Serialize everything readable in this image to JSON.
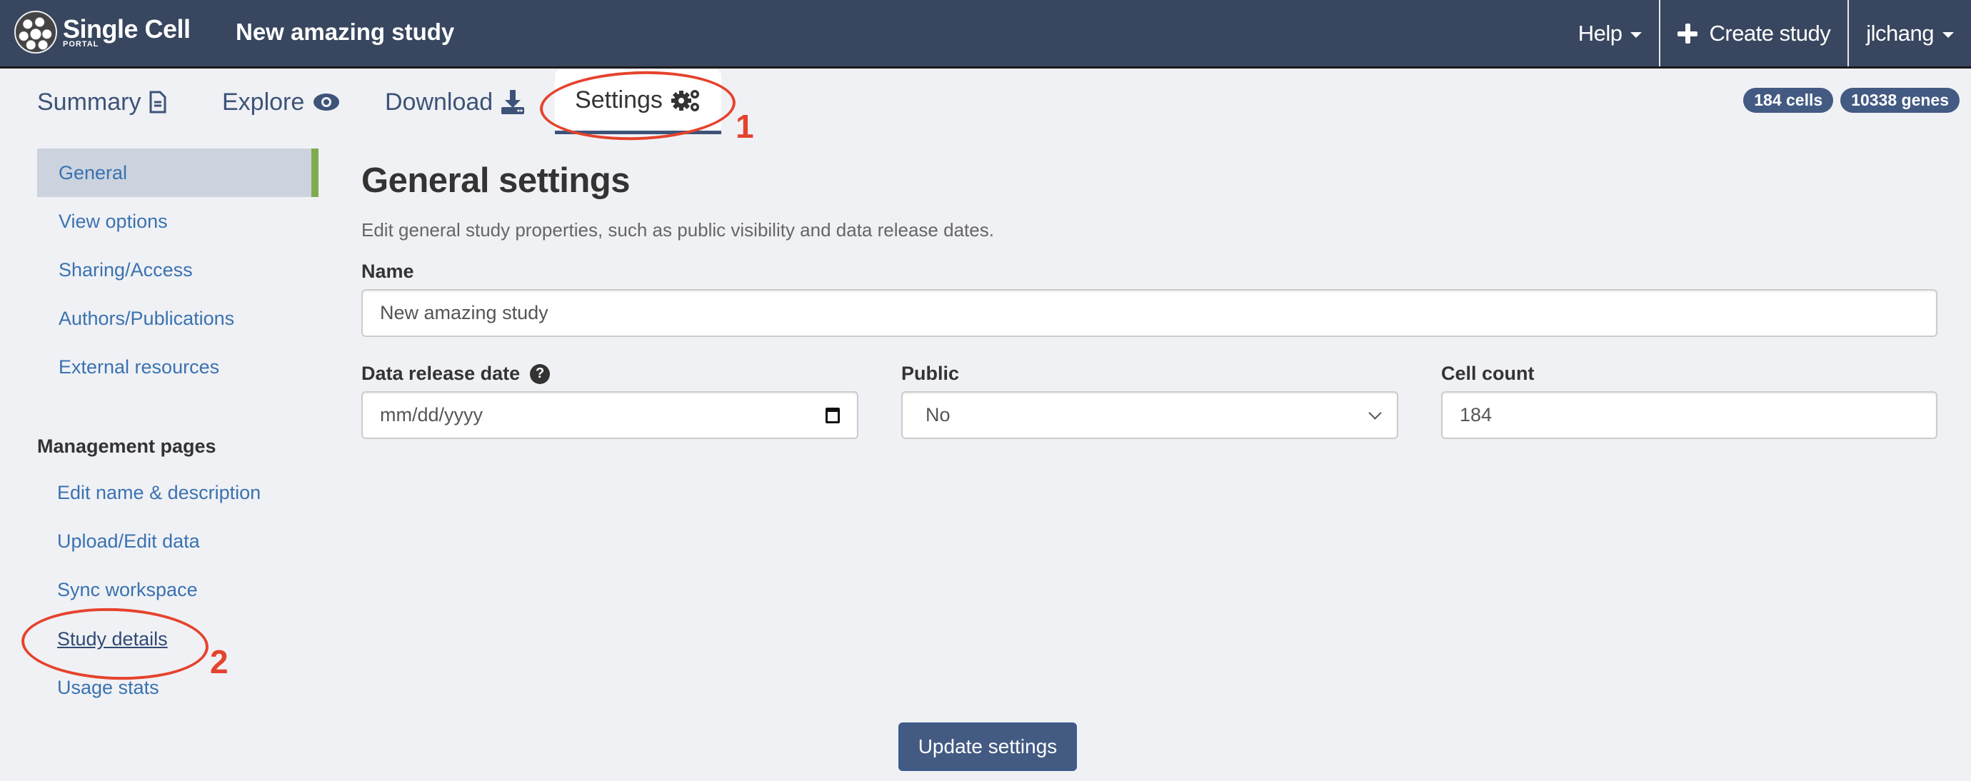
{
  "header": {
    "logo_main": "Single Cell",
    "logo_sub": "PORTAL",
    "study_title": "New amazing study",
    "nav": {
      "help": "Help",
      "create_study": "Create study",
      "user": "jlchang"
    }
  },
  "tabs": [
    {
      "label": "Summary",
      "icon": "document-icon"
    },
    {
      "label": "Explore",
      "icon": "eye-icon"
    },
    {
      "label": "Download",
      "icon": "download-icon"
    },
    {
      "label": "Settings",
      "icon": "gears-icon",
      "active": true
    }
  ],
  "badges": {
    "cells": "184 cells",
    "genes": "10338 genes"
  },
  "sidebar": {
    "items": [
      {
        "label": "General",
        "active": true
      },
      {
        "label": "View options"
      },
      {
        "label": "Sharing/Access"
      },
      {
        "label": "Authors/Publications"
      },
      {
        "label": "External resources"
      }
    ],
    "management_heading": "Management pages",
    "management_items": [
      {
        "label": "Edit name & description"
      },
      {
        "label": "Upload/Edit data"
      },
      {
        "label": "Sync workspace"
      },
      {
        "label": "Study details"
      },
      {
        "label": "Usage stats"
      }
    ]
  },
  "main": {
    "title": "General settings",
    "description": "Edit general study properties, such as public visibility and data release dates.",
    "fields": {
      "name": {
        "label": "Name",
        "value": "New amazing study"
      },
      "release_date": {
        "label": "Data release date",
        "placeholder": "mm/dd/yyyy"
      },
      "public": {
        "label": "Public",
        "value": "No"
      },
      "cell_count": {
        "label": "Cell count",
        "value": "184"
      }
    },
    "submit_label": "Update settings"
  },
  "annotations": {
    "one": "1",
    "two": "2",
    "color": "#e5432d"
  }
}
